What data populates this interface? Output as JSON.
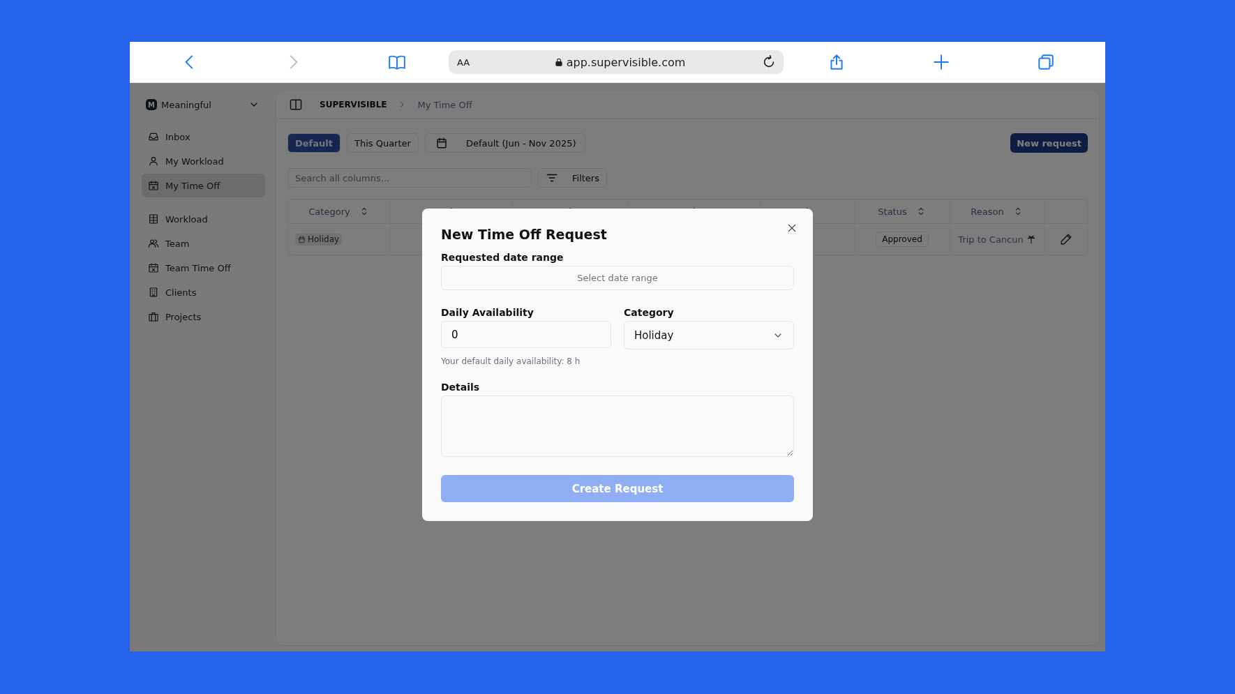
{
  "browser": {
    "text_size": "AA",
    "url": "app.supervisible.com"
  },
  "workspace": {
    "initial": "M",
    "name": "Meaningful"
  },
  "sidebar": {
    "groups": [
      [
        {
          "label": "Inbox",
          "selected": false
        },
        {
          "label": "My Workload",
          "selected": false
        },
        {
          "label": "My Time Off",
          "selected": true
        }
      ],
      [
        {
          "label": "Workload",
          "selected": false
        },
        {
          "label": "Team",
          "selected": false
        },
        {
          "label": "Team Time Off",
          "selected": false
        },
        {
          "label": "Clients",
          "selected": false
        },
        {
          "label": "Projects",
          "selected": false
        }
      ]
    ]
  },
  "breadcrumb": [
    "SUPERVISIBLE",
    "My Time Off"
  ],
  "views": [
    {
      "label": "Default",
      "selected": true
    },
    {
      "label": "This Quarter",
      "selected": false
    }
  ],
  "date_range": "Default (Jun - Nov 2025)",
  "new_request": "New request",
  "search": {
    "placeholder": "Search all columns..."
  },
  "filters": "Filters",
  "table": {
    "columns": [
      {
        "label": "Category"
      },
      {},
      {},
      {},
      {},
      {
        "label": "Status"
      },
      {
        "label": "Reason"
      }
    ],
    "rows": [
      {
        "category": "Holiday",
        "status": "Approved",
        "reason": "Trip to Cancun"
      }
    ]
  },
  "modal": {
    "title": "New Time Off Request",
    "date_label": "Requested date range",
    "date_placeholder": "Select date range",
    "availability_label": "Daily Availability",
    "availability_value": "0",
    "category_label": "Category",
    "category_value": "Holiday",
    "hint": "Your default daily availability: 8 h",
    "details_label": "Details",
    "submit": {
      "label": "Create Request",
      "disabled": true
    }
  }
}
